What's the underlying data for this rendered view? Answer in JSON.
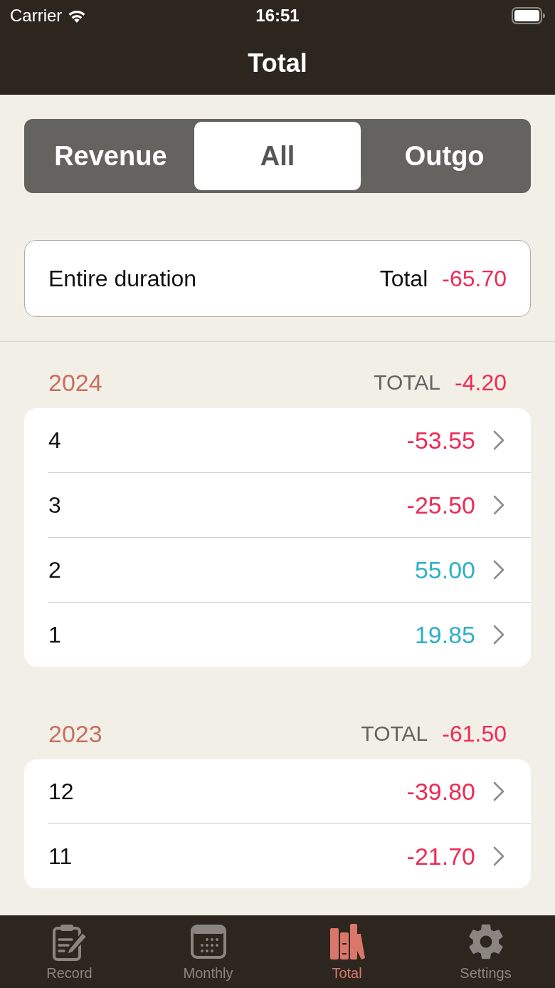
{
  "status_bar": {
    "carrier": "Carrier",
    "time": "16:51"
  },
  "nav_bar": {
    "title": "Total"
  },
  "segmented_control": [
    {
      "label": "Revenue",
      "selected": false
    },
    {
      "label": "All",
      "selected": true
    },
    {
      "label": "Outgo",
      "selected": false
    }
  ],
  "summary": {
    "label": "Entire duration",
    "total_label": "Total",
    "total_value": "-65.70",
    "color": "#ee2a55"
  },
  "sections": [
    {
      "year": "2024",
      "total_label": "TOTAL",
      "total_value": "-4.20",
      "color": "#ee2a55",
      "months": [
        {
          "month": "4",
          "amount": "-53.55",
          "color": "#ee2a55"
        },
        {
          "month": "3",
          "amount": "-25.50",
          "color": "#ee2a55"
        },
        {
          "month": "2",
          "amount": "55.00",
          "color": "#2fb0c6"
        },
        {
          "month": "1",
          "amount": "19.85",
          "color": "#2fb0c6"
        }
      ]
    },
    {
      "year": "2023",
      "total_label": "TOTAL",
      "total_value": "-61.50",
      "color": "#ee2a55",
      "months": [
        {
          "month": "12",
          "amount": "-39.80",
          "color": "#ee2a55"
        },
        {
          "month": "11",
          "amount": "-21.70",
          "color": "#ee2a55"
        }
      ]
    }
  ],
  "tab_bar": [
    {
      "label": "Record",
      "selected": false
    },
    {
      "label": "Monthly",
      "selected": false
    },
    {
      "label": "Total",
      "selected": true
    },
    {
      "label": "Settings",
      "selected": false
    }
  ]
}
